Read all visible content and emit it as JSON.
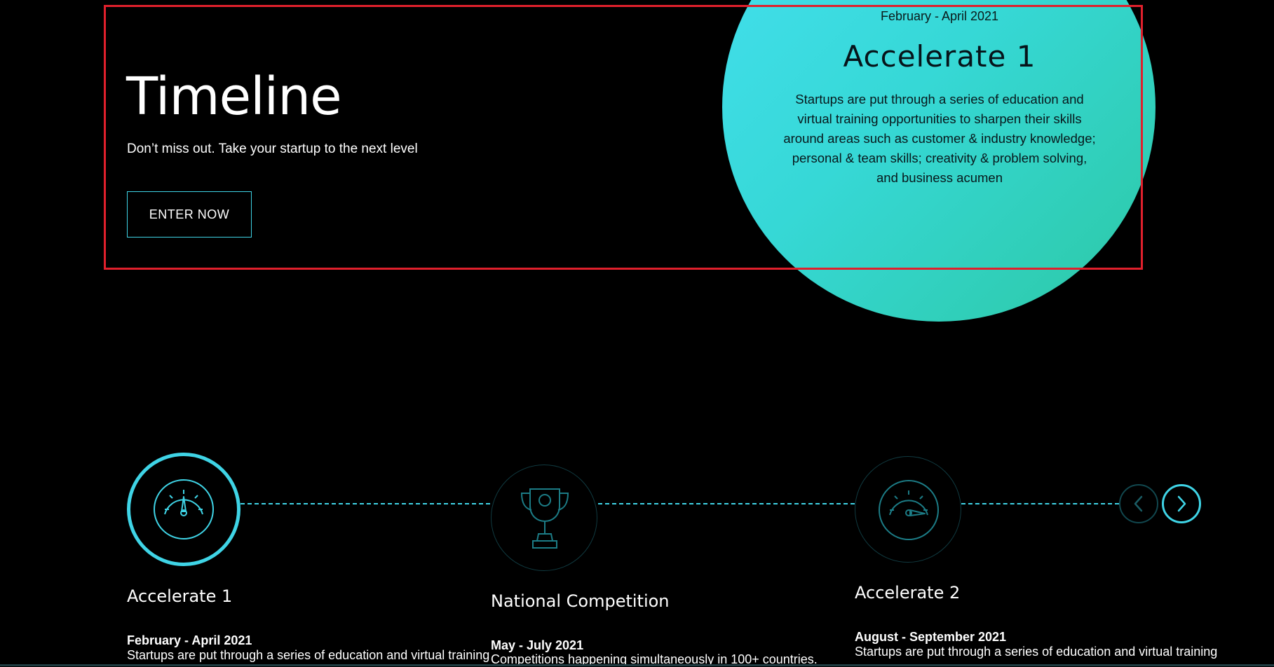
{
  "hero": {
    "title": "Timeline",
    "subtitle": "Don’t miss out. Take your startup to the next level",
    "cta_label": "ENTER NOW"
  },
  "feature": {
    "date": "February - April 2021",
    "title": "Accelerate 1",
    "description": "Startups are put through a series of education and virtual training opportunities to sharpen their skills around areas such as customer & industry knowledge; personal & team skills; creativity & problem solving, and business acumen"
  },
  "timeline": {
    "steps": [
      {
        "title": "Accelerate 1",
        "date": "February - April 2021",
        "text": "Startups are put through a series of education and virtual training",
        "icon": "speedometer-icon",
        "active": true
      },
      {
        "title": "National Competition",
        "date": "May - July 2021",
        "text": "Competitions happening simultaneously in 100+ countries.",
        "icon": "trophy-icon",
        "active": false
      },
      {
        "title": "Accelerate 2",
        "date": "August - September 2021",
        "text": "Startups are put through a series of education and virtual training",
        "icon": "speedometer-icon",
        "active": false
      }
    ],
    "nav": {
      "prev_icon": "chevron-left-icon",
      "next_icon": "chevron-right-icon"
    }
  },
  "colors": {
    "accent": "#3fd4e6",
    "background": "#000000",
    "circle_gradient_start": "#44e0f0",
    "circle_gradient_end": "#2cc8a4",
    "annotation": "#e0202c"
  }
}
